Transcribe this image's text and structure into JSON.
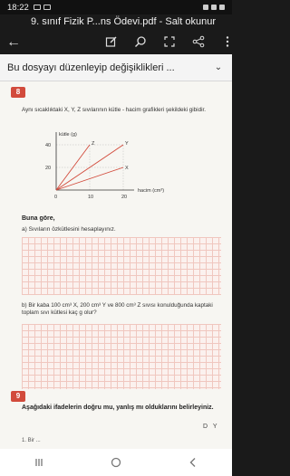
{
  "status": {
    "time": "18:22"
  },
  "app": {
    "title": "9. sınıf Fizik P...ns Ödevi.pdf - Salt okunur"
  },
  "banner": {
    "text": "Bu dosyayı düzenleyip değişiklikleri ..."
  },
  "question8": {
    "number": "8",
    "text": "Aynı sıcaklıktaki X, Y, Z sıvılarının kütle - hacim grafikleri şekildeki gibidir.",
    "buna_gore": "Buna göre,",
    "part_a": "a)  Sıvıların özkütlesini hesaplayınız.",
    "part_b": "b)  Bir kaba 100 cm³ X, 200 cm³ Y ve 800 cm³ Z sıvısı konulduğunda kaptaki toplam sıvı kütlesi kaç g olur?"
  },
  "question9": {
    "number": "9",
    "text": "Aşağıdaki ifadelerin doğru mu, yanlış mı olduklarını belirleyiniz.",
    "header": "D  Y",
    "first_line": "1.   Bir ..."
  },
  "colors": {
    "accent": "#d24b3c",
    "grid_line": "#f0c7bf"
  },
  "chart_data": {
    "type": "line",
    "ylabel": "kütle (g)",
    "xlabel": "hacim (cm³)",
    "x_ticks": [
      "0",
      "10",
      "20"
    ],
    "y_ticks": [
      "20",
      "40"
    ],
    "xlim": [
      0,
      20
    ],
    "ylim": [
      0,
      40
    ],
    "series": [
      {
        "name": "Z",
        "x": [
          0,
          10
        ],
        "y": [
          0,
          40
        ]
      },
      {
        "name": "Y",
        "x": [
          0,
          20
        ],
        "y": [
          0,
          40
        ]
      },
      {
        "name": "X",
        "x": [
          0,
          20
        ],
        "y": [
          0,
          20
        ]
      }
    ]
  }
}
